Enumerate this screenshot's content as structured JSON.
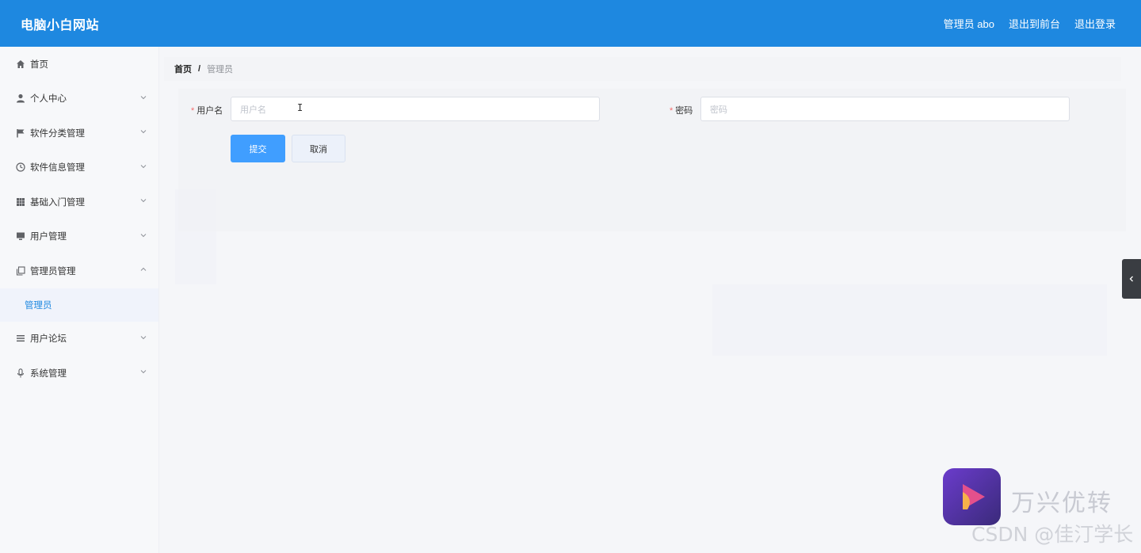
{
  "header": {
    "brand": "电脑小白网站",
    "user_label": "管理员 abo",
    "to_front": "退出到前台",
    "logout": "退出登录"
  },
  "sidebar": {
    "items": [
      {
        "label": "首页",
        "icon": "home-icon",
        "has_children": false
      },
      {
        "label": "个人中心",
        "icon": "user-icon",
        "has_children": true
      },
      {
        "label": "软件分类管理",
        "icon": "flag-icon",
        "has_children": true
      },
      {
        "label": "软件信息管理",
        "icon": "clock-icon",
        "has_children": true
      },
      {
        "label": "基础入门管理",
        "icon": "grid-icon",
        "has_children": true
      },
      {
        "label": "用户管理",
        "icon": "monitor-icon",
        "has_children": true
      },
      {
        "label": "管理员管理",
        "icon": "copy-icon",
        "has_children": true,
        "expanded": true
      },
      {
        "label": "用户论坛",
        "icon": "list-icon",
        "has_children": true
      },
      {
        "label": "系统管理",
        "icon": "microphone-icon",
        "has_children": true
      }
    ],
    "active_sub": "管理员"
  },
  "breadcrumb": {
    "home": "首页",
    "separator": "/",
    "current": "管理员"
  },
  "form": {
    "username_label": "用户名",
    "username_placeholder": "用户名",
    "password_label": "密码",
    "password_placeholder": "密码",
    "submit_label": "提交",
    "cancel_label": "取消",
    "required_mark": "*"
  },
  "watermark": {
    "brand": "万兴优转",
    "csdn": "CSDN @佳汀学长"
  },
  "colors": {
    "header_bg": "#1e88e0",
    "primary": "#409eff",
    "required": "#f56c6c",
    "active_sub": "#1e88e0"
  }
}
